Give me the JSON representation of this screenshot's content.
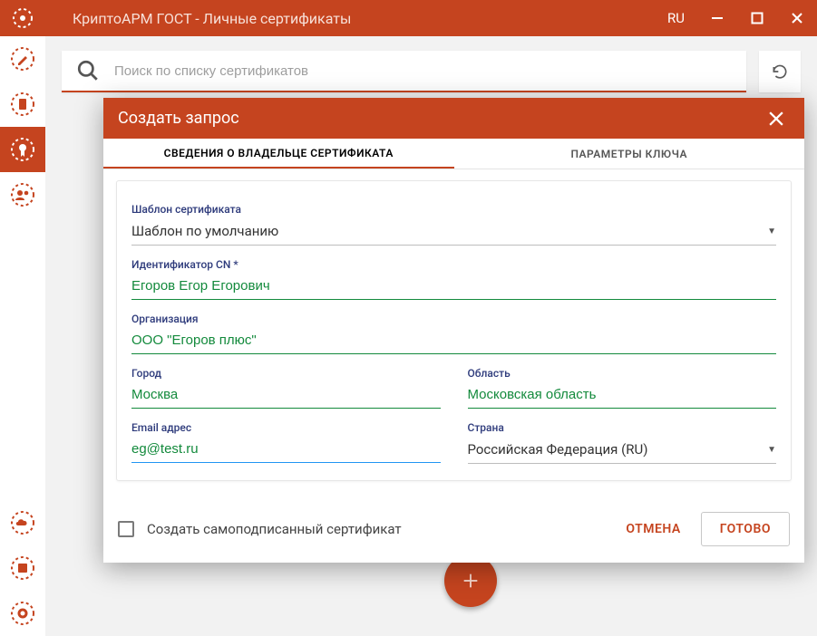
{
  "window": {
    "title": "КриптоАРМ ГОСТ - Личные сертификаты",
    "language": "RU"
  },
  "search": {
    "placeholder": "Поиск по списку сертификатов",
    "value": ""
  },
  "sidebar": {
    "items": [
      {
        "name": "pen-icon"
      },
      {
        "name": "doc-icon"
      },
      {
        "name": "cert-icon"
      },
      {
        "name": "users-icon"
      },
      {
        "name": "cloud-icon"
      },
      {
        "name": "report-icon"
      },
      {
        "name": "settings-icon"
      }
    ],
    "active_index": 2
  },
  "fab": {
    "icon": "plus"
  },
  "dialog": {
    "title": "Создать запрос",
    "tabs": {
      "owner": "СВЕДЕНИЯ О ВЛАДЕЛЬЦЕ СЕРТИФИКАТА",
      "key_params": "ПАРАМЕТРЫ КЛЮЧА",
      "active": "owner"
    },
    "fields": {
      "template_label": "Шаблон сертификата",
      "template_value": "Шаблон по умолчанию",
      "cn_label": "Идентификатор CN *",
      "cn_value": "Егоров Егор Егорович",
      "org_label": "Организация",
      "org_value": "ООО \"Егоров плюс\"",
      "city_label": "Город",
      "city_value": "Москва",
      "region_label": "Область",
      "region_value": "Московская область",
      "email_label": "Email адрес",
      "email_value": "eg@test.ru",
      "country_label": "Страна",
      "country_value": "Российская Федерация (RU)"
    },
    "footer": {
      "selfsigned_label": "Создать самоподписанный сертификат",
      "selfsigned_checked": false,
      "cancel": "ОТМЕНА",
      "done": "ГОТОВО"
    }
  }
}
